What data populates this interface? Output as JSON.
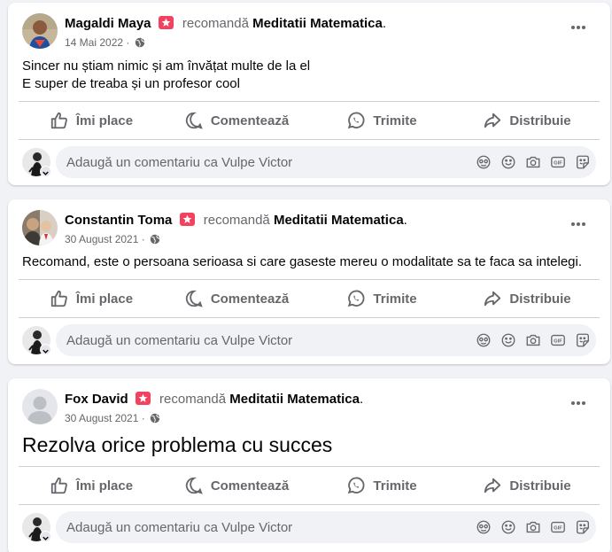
{
  "viewer": {
    "comment_placeholder": "Adaugă un comentariu ca Vulpe Victor"
  },
  "actions": {
    "like": "Îmi place",
    "comment": "Comentează",
    "send": "Trimite",
    "share": "Distribuie"
  },
  "colors": {
    "accent_badge": "#f3425f",
    "secondary_text": "#65676b",
    "divider": "#ced0d4",
    "background": "#f0f2f5"
  },
  "posts": [
    {
      "author": "Magaldi Maya",
      "verb": "recomandă",
      "page": "Meditatii Matematica",
      "period": ".",
      "date": "14 Mai 2022",
      "date_sep": "·",
      "lines": [
        "Sincer nu știam nimic și am învățat multe de la el",
        "E super de treaba și un profesor cool"
      ]
    },
    {
      "author": "Constantin Toma",
      "verb": "recomandă",
      "page": "Meditatii Matematica",
      "period": ".",
      "date": "30 August 2021",
      "date_sep": "·",
      "lines": [
        "Recomand, este o persoana serioasa si care gaseste mereu o modalitate sa te faca sa intelegi."
      ]
    },
    {
      "author": "Fox David",
      "verb": "recomandă",
      "page": "Meditatii Matematica",
      "period": ".",
      "date": "30 August 2021",
      "date_sep": "·",
      "lines": [
        "Rezolva orice problema cu succes"
      ]
    }
  ],
  "icons": [
    "star-badge-icon",
    "globe-icon",
    "more-icon",
    "like-icon",
    "comment-icon",
    "whatsapp-icon",
    "share-icon",
    "avatar-icon",
    "sticker-icon",
    "emoji-icon",
    "camera-icon",
    "gif-icon",
    "sticker-smile-icon"
  ]
}
